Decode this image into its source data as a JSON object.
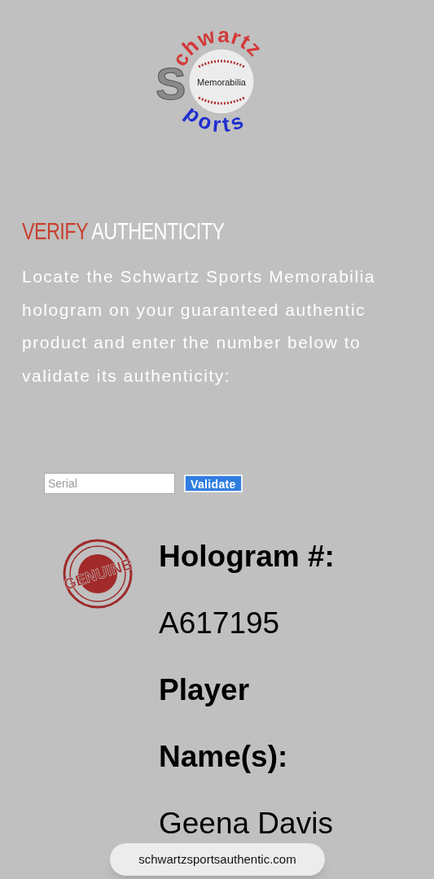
{
  "logo": {
    "initial": "S",
    "top_arc": "chwartz",
    "bottom_arc": "ports",
    "center": "Memorabilia"
  },
  "heading": {
    "accent": "VERIFY",
    "rest": "AUTHENTICITY"
  },
  "intro": "Locate the Schwartz Sports Memorabilia hologram on your guaranteed authentic product and enter the number below to validate its authenticity:",
  "serial_field": {
    "placeholder": "Serial"
  },
  "validate_button": "Validate",
  "stamp": {
    "text": "GENUINE"
  },
  "result": [
    {
      "kind": "label",
      "text": "Hologram #:"
    },
    {
      "kind": "value",
      "text": "A617195"
    },
    {
      "kind": "label",
      "text": "Player"
    },
    {
      "kind": "label",
      "text": "Name(s):"
    },
    {
      "kind": "value",
      "text": "Geena Davis"
    }
  ],
  "url_bar": "schwartzsportsauthentic.com"
}
